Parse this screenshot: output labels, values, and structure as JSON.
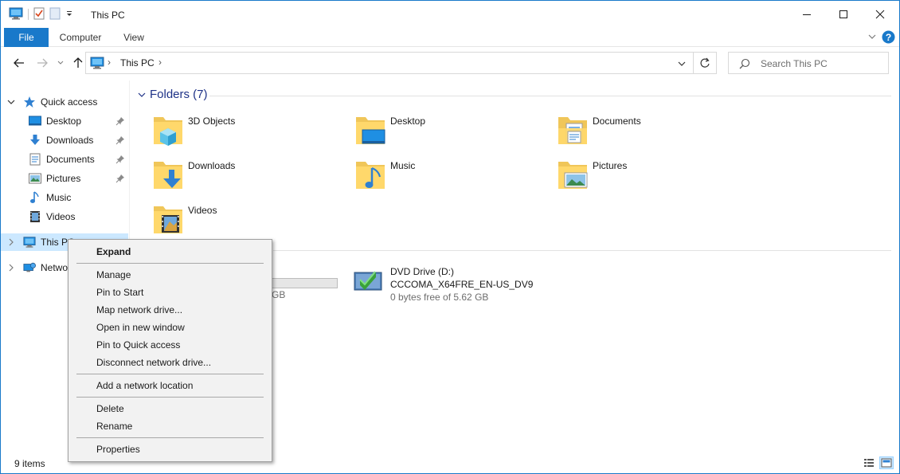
{
  "window": {
    "title": "This PC",
    "accent": "#1979ca"
  },
  "ribbon": {
    "tabs": [
      "File",
      "Computer",
      "View"
    ]
  },
  "address": {
    "crumb": "This PC",
    "separator": "›"
  },
  "search": {
    "placeholder": "Search This PC"
  },
  "nav": {
    "quick_access": "Quick access",
    "quick_items": [
      {
        "label": "Desktop",
        "icon": "desktop-icon",
        "pinned": true
      },
      {
        "label": "Downloads",
        "icon": "downloads-icon",
        "pinned": true
      },
      {
        "label": "Documents",
        "icon": "documents-icon",
        "pinned": true
      },
      {
        "label": "Pictures",
        "icon": "pictures-icon",
        "pinned": true
      },
      {
        "label": "Music",
        "icon": "music-icon",
        "pinned": false
      },
      {
        "label": "Videos",
        "icon": "videos-icon",
        "pinned": false
      }
    ],
    "this_pc": "This PC",
    "network": "Network"
  },
  "content": {
    "folders_header": "Folders (7)",
    "folders": [
      {
        "label": "3D Objects",
        "icon": "3d-objects-icon"
      },
      {
        "label": "Desktop",
        "icon": "desktop-icon"
      },
      {
        "label": "Documents",
        "icon": "documents-icon"
      },
      {
        "label": "Downloads",
        "icon": "downloads-icon"
      },
      {
        "label": "Music",
        "icon": "music-icon"
      },
      {
        "label": "Pictures",
        "icon": "pictures-icon"
      },
      {
        "label": "Videos",
        "icon": "videos-icon"
      }
    ],
    "partial_drive_text": "GB",
    "dvd": {
      "name": "DVD Drive (D:)",
      "label": "CCCOMA_X64FRE_EN-US_DV9",
      "free": "0 bytes free of 5.62 GB"
    }
  },
  "status": {
    "count": "9 items"
  },
  "context_menu": {
    "items": [
      {
        "label": "Expand",
        "bold": true
      },
      {
        "label": "Manage"
      },
      {
        "label": "Pin to Start"
      },
      {
        "label": "Map network drive..."
      },
      {
        "label": "Open in new window"
      },
      {
        "label": "Pin to Quick access"
      },
      {
        "label": "Disconnect network drive..."
      },
      {
        "label": "Add a network location"
      },
      {
        "label": "Delete"
      },
      {
        "label": "Rename"
      },
      {
        "label": "Properties"
      }
    ]
  }
}
